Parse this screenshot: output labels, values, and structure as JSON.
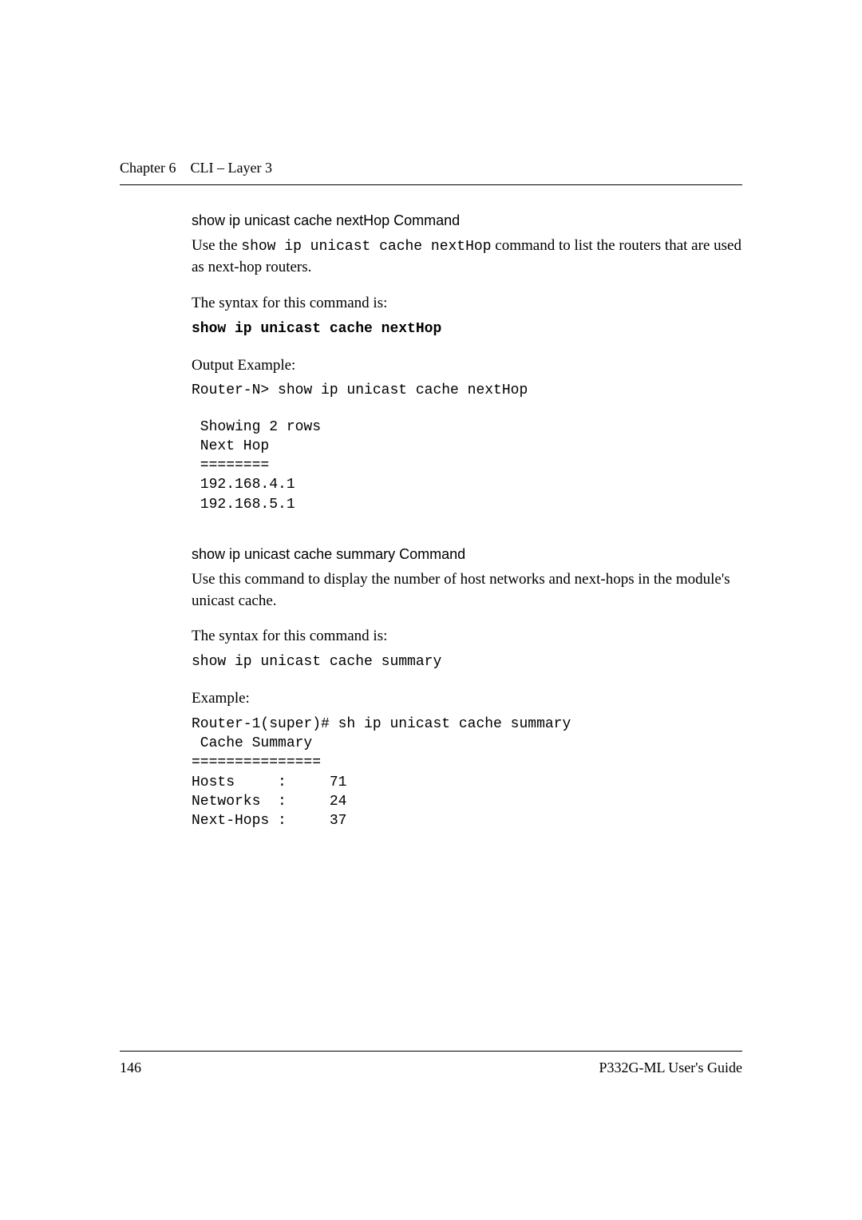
{
  "header": {
    "chapter": "Chapter 6",
    "title": "CLI – Layer 3"
  },
  "section1": {
    "heading": "show ip unicast cache nextHop Command",
    "intro_pre": "Use the ",
    "intro_cmd": "show ip unicast cache nextHop",
    "intro_post": " command to list the routers that are used as next-hop routers.",
    "syntax_label": "The syntax for this command is:",
    "syntax_cmd": "show ip unicast cache nextHop",
    "output_label": "Output Example:",
    "output_line": "Router-N> show ip unicast cache nextHop",
    "output_block": " Showing 2 rows\n Next Hop\n ========\n 192.168.4.1\n 192.168.5.1"
  },
  "section2": {
    "heading": "show ip unicast cache summary Command",
    "intro": "Use this command to display the number of host networks and next-hops in the module's unicast cache.",
    "syntax_label": "The syntax for this command is:",
    "syntax_cmd": "show ip unicast cache summary",
    "example_label": "Example:",
    "example_block": "Router-1(super)# sh ip unicast cache summary\n Cache Summary\n===============\nHosts     :     71\nNetworks  :     24\nNext-Hops :     37"
  },
  "footer": {
    "page_number": "146",
    "doc_title": "P332G-ML User's Guide"
  }
}
